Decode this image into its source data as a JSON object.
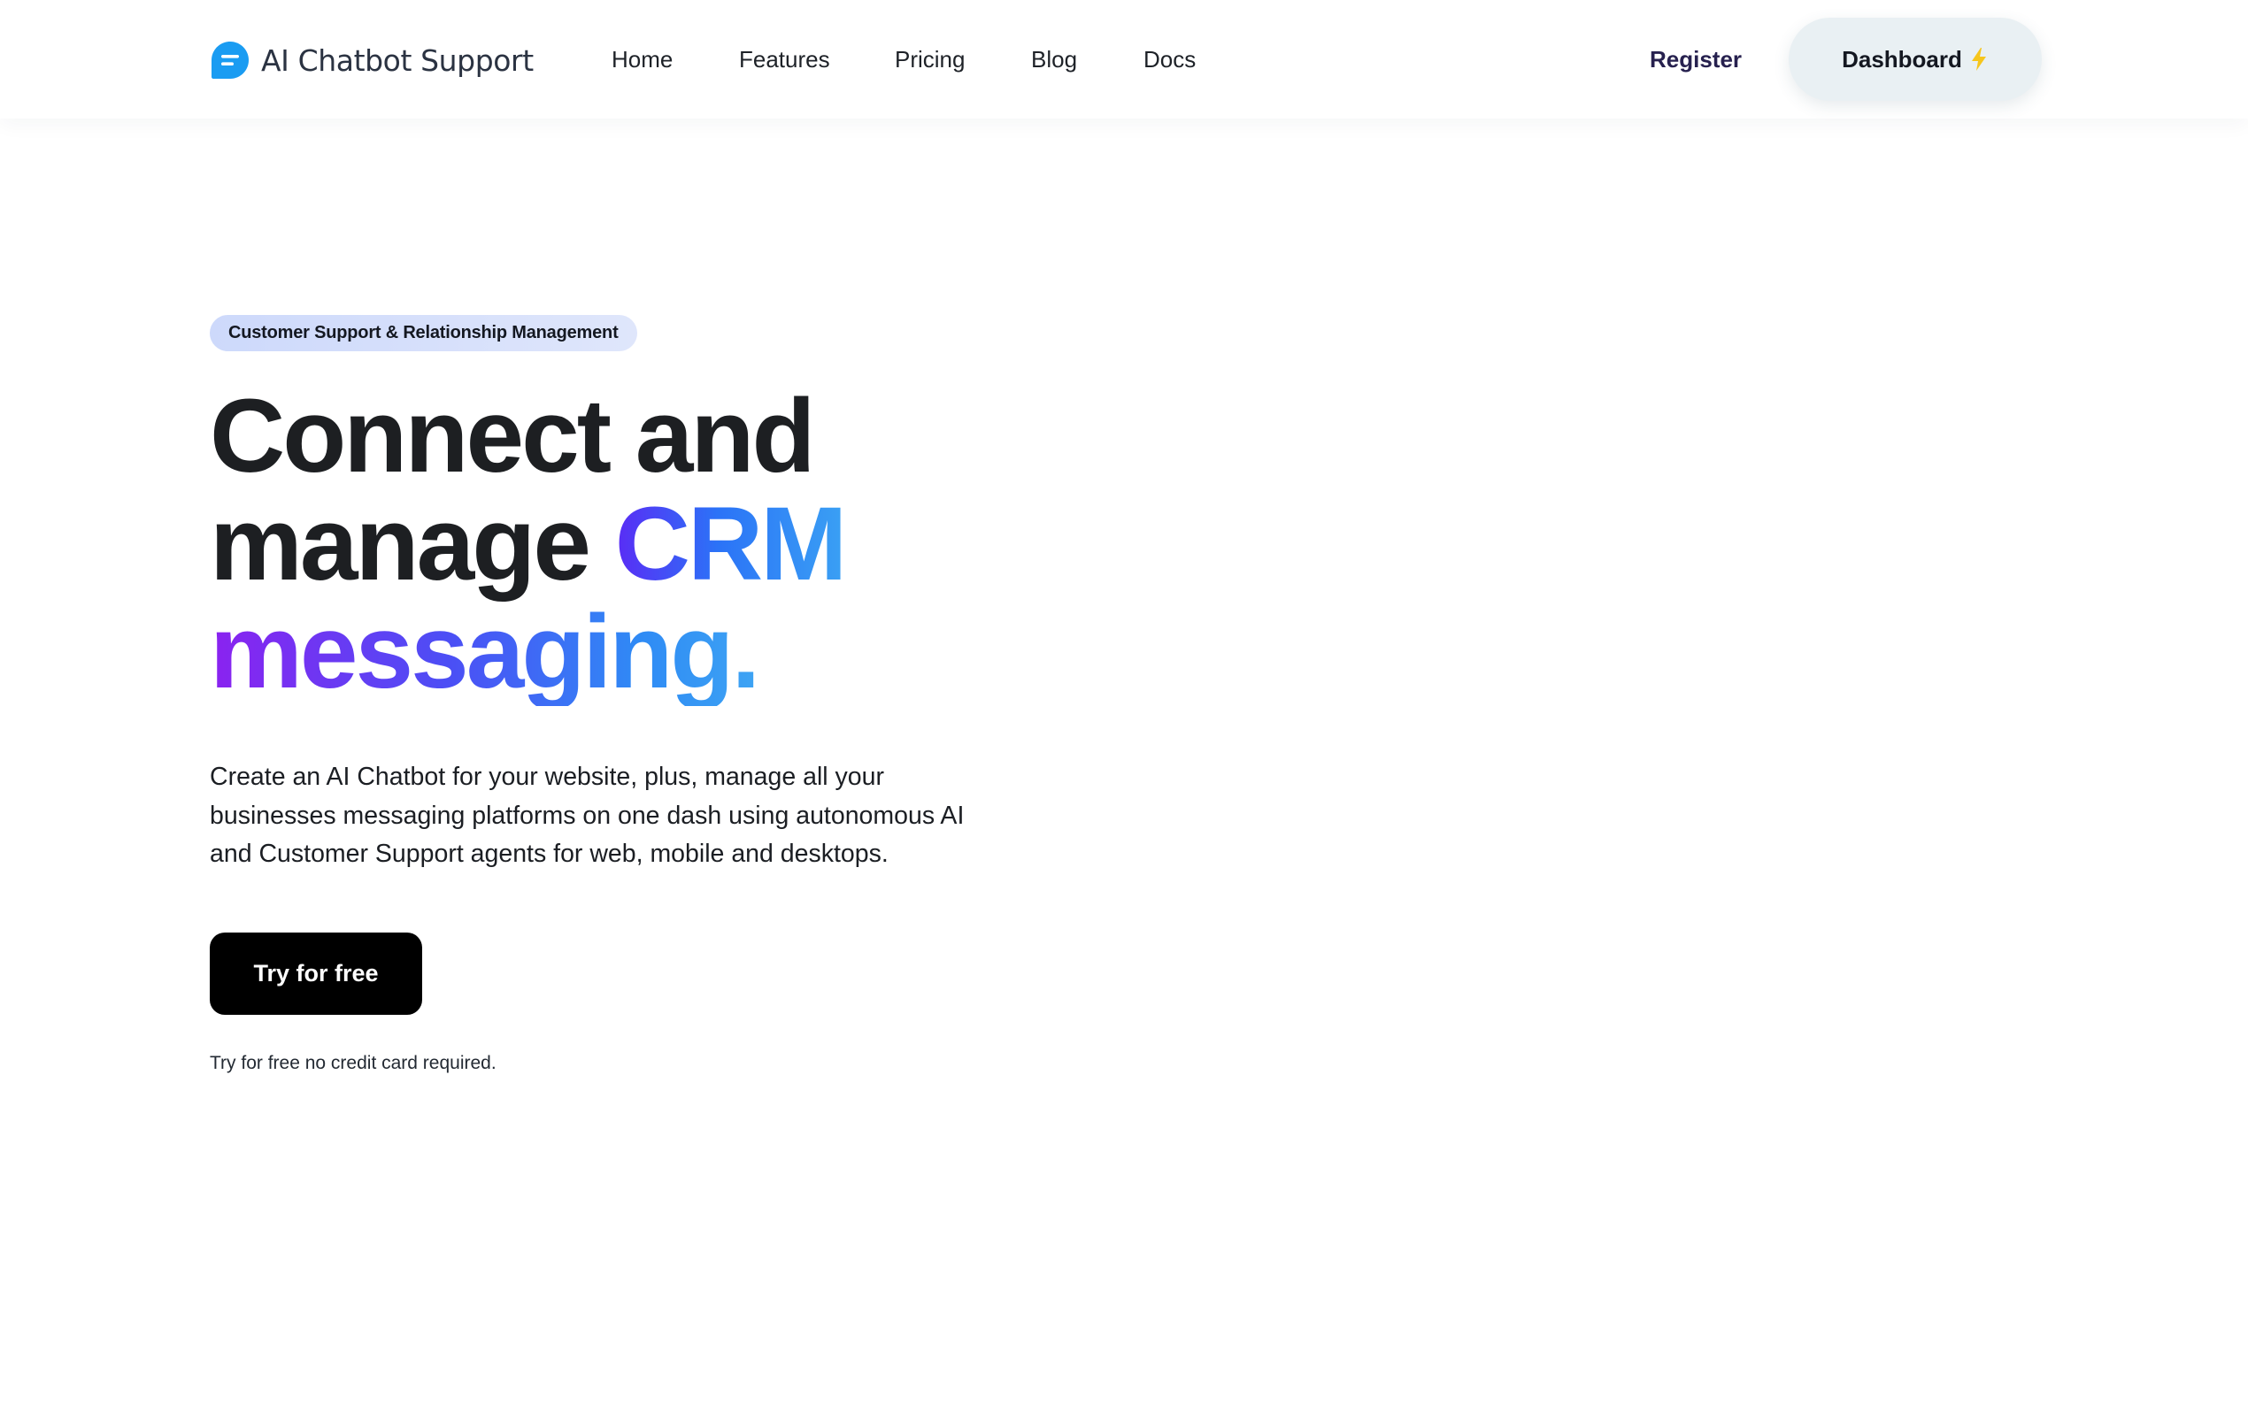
{
  "header": {
    "brand": {
      "name": "AI Chatbot Support",
      "icon": "chat-bubble-icon",
      "icon_color": "#1a9cf2"
    },
    "nav": [
      {
        "label": "Home"
      },
      {
        "label": "Features"
      },
      {
        "label": "Pricing"
      },
      {
        "label": "Blog"
      },
      {
        "label": "Docs"
      }
    ],
    "register_label": "Register",
    "dashboard": {
      "label": "Dashboard",
      "icon": "lightning-bolt-icon",
      "icon_color": "#f6c61d"
    }
  },
  "hero": {
    "badge": "Customer Support & Relationship Management",
    "headline": {
      "line1": "Connect and",
      "line2_plain": "manage ",
      "line2_gradient": "CRM",
      "line3_gradient": "messaging."
    },
    "description": "Create an AI Chatbot for your website, plus, manage all your businesses messaging platforms on one dash using autonomous AI and Customer Support agents for web, mobile and desktops.",
    "cta_label": "Try for free",
    "cta_note": "Try for free no credit card required."
  },
  "colors": {
    "gradient_start": "#8b22f0",
    "gradient_mid": "#2b73f7",
    "gradient_end": "#49b6f2",
    "cta_background": "#000000",
    "dashboard_background": "#e9f0f3",
    "badge_background": "#d5dffb"
  }
}
